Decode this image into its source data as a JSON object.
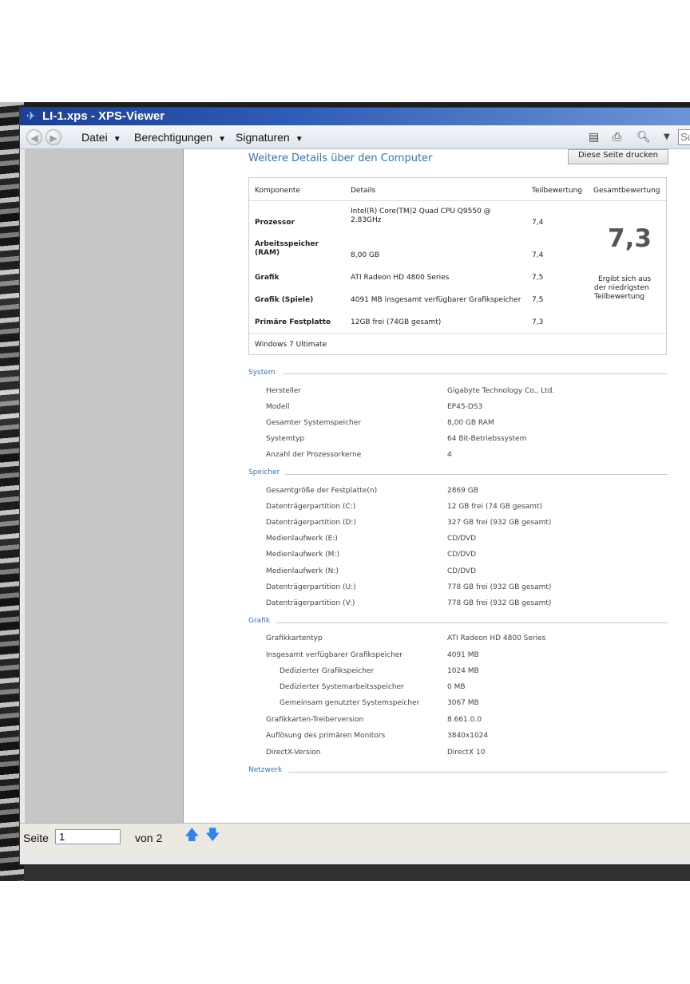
{
  "window": {
    "title": "LI-1.xps - XPS-Viewer"
  },
  "menubar": {
    "datei": "Datei",
    "berechtigungen": "Berechtigungen",
    "signaturen": "Signaturen",
    "search_placeholder": "Su"
  },
  "statusbar": {
    "page_label": "Seite",
    "page_value": "1",
    "of_label": "von 2"
  },
  "doc": {
    "title": "Weitere Details über den Computer",
    "print_button": "Diese Seite drucken",
    "summary": {
      "headers": {
        "component": "Komponente",
        "details": "Details",
        "sub": "Teilbewertung",
        "total": "Gesamtbewertung"
      },
      "rows": [
        {
          "component": "Prozessor",
          "details_1": "Intel(R) Core(TM)2 Quad CPU Q9550 @",
          "details_2": "2.83GHz",
          "score": "7,4"
        },
        {
          "component_1": "Arbeitsspeicher",
          "component_2": "(RAM)",
          "details": "8,00 GB",
          "score": "7,4"
        },
        {
          "component": "Grafik",
          "details": "ATI Radeon HD 4800 Series",
          "score": "7,5"
        },
        {
          "component": "Grafik (Spiele)",
          "details": "4091 MB insgesamt verfügbarer Grafikspeicher",
          "score": "7,5"
        },
        {
          "component": "Primäre Festplatte",
          "details": "12GB frei (74GB gesamt)",
          "score": "7,3"
        }
      ],
      "total_score": "7,3",
      "total_note_1": "Ergibt sich aus",
      "total_note_2": "der niedrigsten",
      "total_note_3": "Teilbewertung",
      "os": "Windows 7 Ultimate"
    },
    "system": {
      "heading": "System",
      "rows": [
        {
          "label": "Hersteller",
          "value": "Gigabyte Technology Co., Ltd."
        },
        {
          "label": "Modell",
          "value": "EP45-DS3"
        },
        {
          "label": "Gesamter Systemspeicher",
          "value": "8,00 GB RAM"
        },
        {
          "label": "Systemtyp",
          "value": "64 Bit-Betriebssystem"
        },
        {
          "label": "Anzahl der Prozessorkerne",
          "value": "4"
        }
      ]
    },
    "speicher": {
      "heading": "Speicher",
      "rows": [
        {
          "label": "Gesamtgröße der Festplatte(n)",
          "value": "2869 GB"
        },
        {
          "label": "Datenträgerpartition (C:)",
          "value": "12 GB frei (74 GB gesamt)"
        },
        {
          "label": "Datenträgerpartition (D:)",
          "value": "327 GB frei (932 GB gesamt)"
        },
        {
          "label": "Medienlaufwerk (E:)",
          "value": "CD/DVD"
        },
        {
          "label": "Medienlaufwerk (M:)",
          "value": "CD/DVD"
        },
        {
          "label": "Medienlaufwerk (N:)",
          "value": "CD/DVD"
        },
        {
          "label": "Datenträgerpartition (U:)",
          "value": "778 GB frei (932 GB gesamt)"
        },
        {
          "label": "Datenträgerpartition (V:)",
          "value": "778 GB frei (932 GB gesamt)"
        }
      ]
    },
    "grafik": {
      "heading": "Grafik",
      "rows": [
        {
          "label": "Grafikkartentyp",
          "value": "ATI Radeon HD 4800 Series"
        },
        {
          "label": "Insgesamt verfügbarer Grafikspeicher",
          "value": "4091 MB"
        },
        {
          "label": "Dedizierter Grafikspeicher",
          "value": "1024 MB"
        },
        {
          "label": "Dedizierter Systemarbeitsspeicher",
          "value": "0 MB"
        },
        {
          "label": "Gemeinsam genutzter Systemspeicher",
          "value": "3067 MB"
        },
        {
          "label": "Grafikkarten-Treiberversion",
          "value": "8.661.0.0"
        },
        {
          "label": "Auflösung des primären Monitors",
          "value": "3840x1024"
        },
        {
          "label": "DirectX-Version",
          "value": "DirectX 10"
        }
      ]
    },
    "netzwerk": {
      "heading": "Netzwerk"
    }
  }
}
